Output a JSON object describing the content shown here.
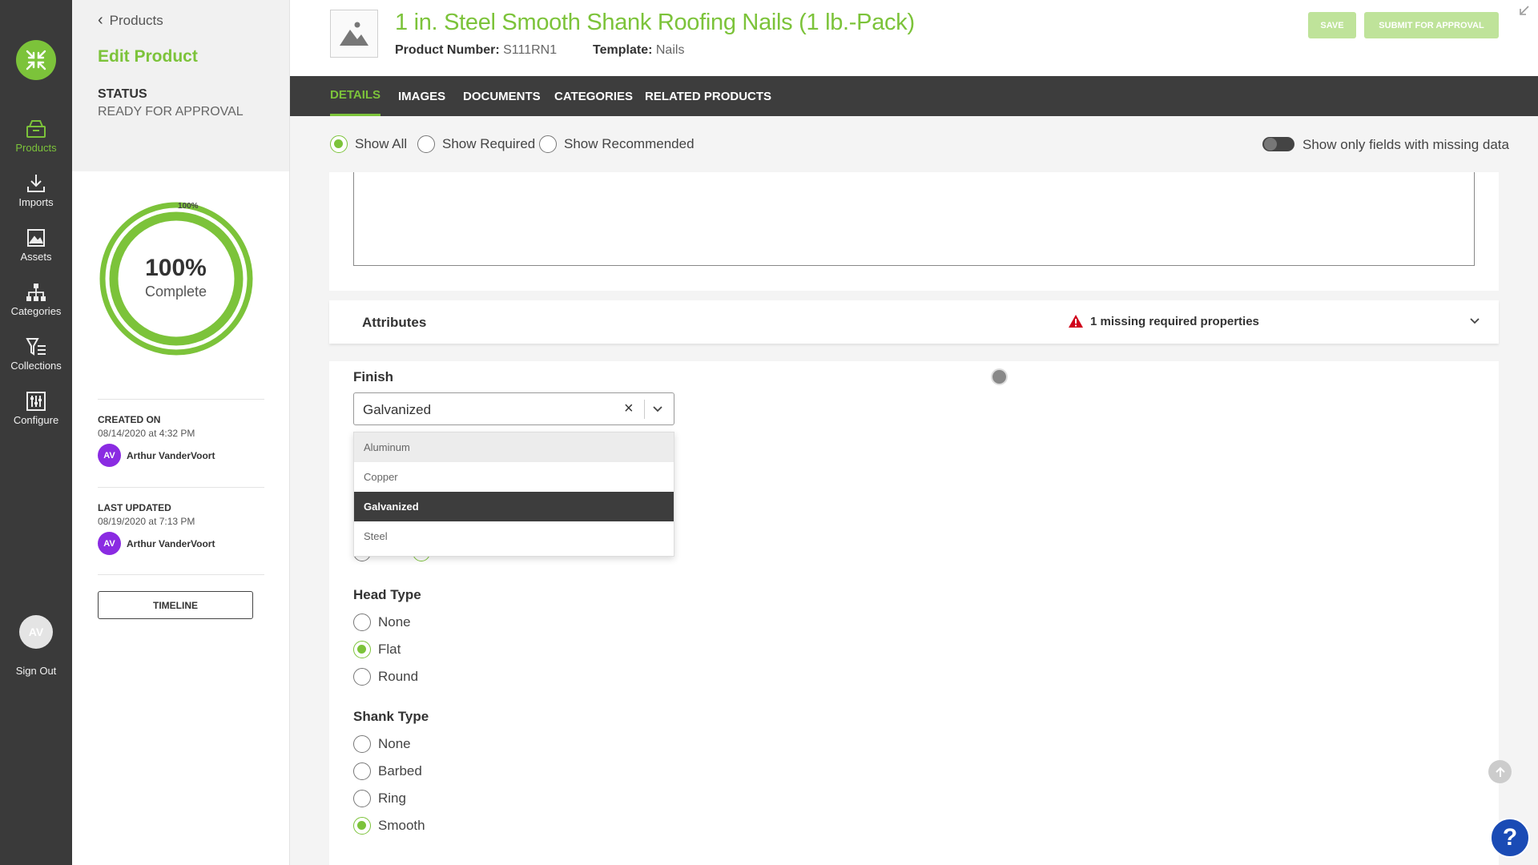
{
  "rail": {
    "items": [
      {
        "label": "Products",
        "icon": "box-icon"
      },
      {
        "label": "Imports",
        "icon": "download-icon"
      },
      {
        "label": "Assets",
        "icon": "image-icon"
      },
      {
        "label": "Categories",
        "icon": "hierarchy-icon"
      },
      {
        "label": "Collections",
        "icon": "filter-list-icon"
      },
      {
        "label": "Configure",
        "icon": "sliders-icon"
      }
    ],
    "avatar_initials": "AV",
    "signout_label": "Sign Out"
  },
  "panel": {
    "back_label": "Products",
    "edit_title": "Edit Product",
    "status_label": "STATUS",
    "status_value": "READY FOR APPROVAL",
    "completion": {
      "small_label": "100%",
      "percent_label": "100%",
      "sub_label": "Complete",
      "fraction": 1.0
    },
    "created": {
      "label": "CREATED ON",
      "date": "08/14/2020 at 4:32 PM",
      "initials": "AV",
      "user": "Arthur VanderVoort"
    },
    "updated": {
      "label": "LAST UPDATED",
      "date": "08/19/2020 at 7:13 PM",
      "initials": "AV",
      "user": "Arthur VanderVoort"
    },
    "timeline_label": "TIMELINE"
  },
  "header": {
    "title": "1 in. Steel Smooth Shank Roofing Nails (1 lb.-Pack)",
    "product_number_label": "Product Number:",
    "product_number": "S111RN1",
    "template_label": "Template:",
    "template": "Nails",
    "save_label": "SAVE",
    "submit_label": "SUBMIT FOR APPROVAL"
  },
  "tabs": [
    "DETAILS",
    "IMAGES",
    "DOCUMENTS",
    "CATEGORIES",
    "RELATED PRODUCTS"
  ],
  "filter": {
    "options": [
      "Show All",
      "Show Required",
      "Show Recommended"
    ],
    "selected": "Show All",
    "toggle_label": "Show only fields with missing data"
  },
  "attributes": {
    "title": "Attributes",
    "warning": "1 missing required properties",
    "finish": {
      "label": "Finish",
      "value": "Galvanized",
      "options": [
        "Aluminum",
        "Copper",
        "Galvanized",
        "Steel"
      ]
    },
    "head_type": {
      "label": "Head Type",
      "options": [
        "None",
        "Flat",
        "Round"
      ],
      "selected": "Flat"
    },
    "shank_type": {
      "label": "Shank Type",
      "options": [
        "None",
        "Barbed",
        "Ring",
        "Smooth"
      ],
      "selected": "Smooth"
    }
  },
  "colors": {
    "accent": "#7cc33a",
    "rail": "#3a3a3a",
    "tabs": "#3d3d3d",
    "help": "#1a4bb5"
  }
}
